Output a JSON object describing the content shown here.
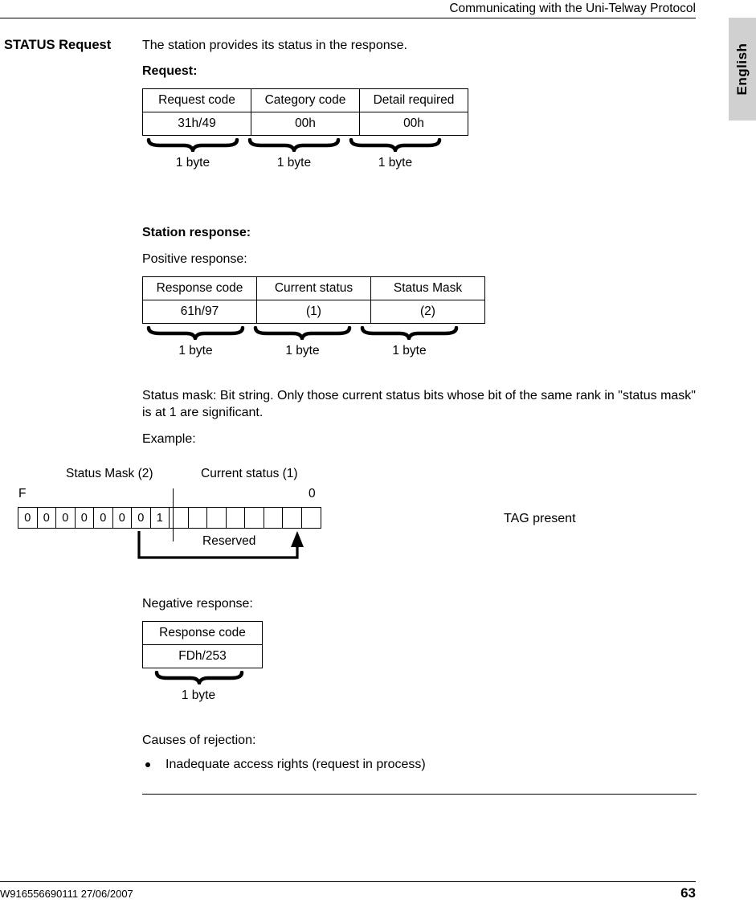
{
  "header": {
    "title": "Communicating with the Uni-Telway Protocol"
  },
  "side_tab": {
    "label": "English"
  },
  "margin_heading": "STATUS Request",
  "body": {
    "intro": "The station provides its status in the response.",
    "request_heading": "Request:",
    "station_response_heading": "Station response:",
    "positive_response_label": "Positive response:",
    "mask_description": "Status mask: Bit string. Only those current status bits whose bit of the same rank in \"status mask\" is at 1 are significant.",
    "example_label": "Example:",
    "negative_response_label": "Negative response:",
    "causes_label": "Causes of rejection:",
    "causes": [
      "Inadequate access rights (request in process)"
    ]
  },
  "request_table": {
    "headers": [
      "Request code",
      "Category code",
      "Detail required"
    ],
    "values": [
      "31h/49",
      "00h",
      "00h"
    ],
    "byte_labels": [
      "1 byte",
      "1 byte",
      "1 byte"
    ]
  },
  "response_table": {
    "headers": [
      "Response code",
      "Current status",
      "Status Mask"
    ],
    "values": [
      "61h/97",
      "(1)",
      "(2)"
    ],
    "byte_labels": [
      "1 byte",
      "1 byte",
      "1 byte"
    ]
  },
  "negative_table": {
    "headers": [
      "Response code"
    ],
    "values": [
      "FDh/253"
    ],
    "byte_labels": [
      "1 byte"
    ]
  },
  "bit_diagram": {
    "group_mask_label": "Status Mask (2)",
    "group_status_label": "Current status (1)",
    "msb_label": "F",
    "lsb_label": "0",
    "reserved_label": "Reserved",
    "tag_label": "TAG present",
    "bits": [
      "0",
      "0",
      "0",
      "0",
      "0",
      "0",
      "0",
      "1",
      "",
      "",
      "",
      "",
      "",
      "",
      "",
      ""
    ]
  },
  "footer": {
    "document_id": "W916556690111 27/06/2007",
    "page_number": "63"
  }
}
